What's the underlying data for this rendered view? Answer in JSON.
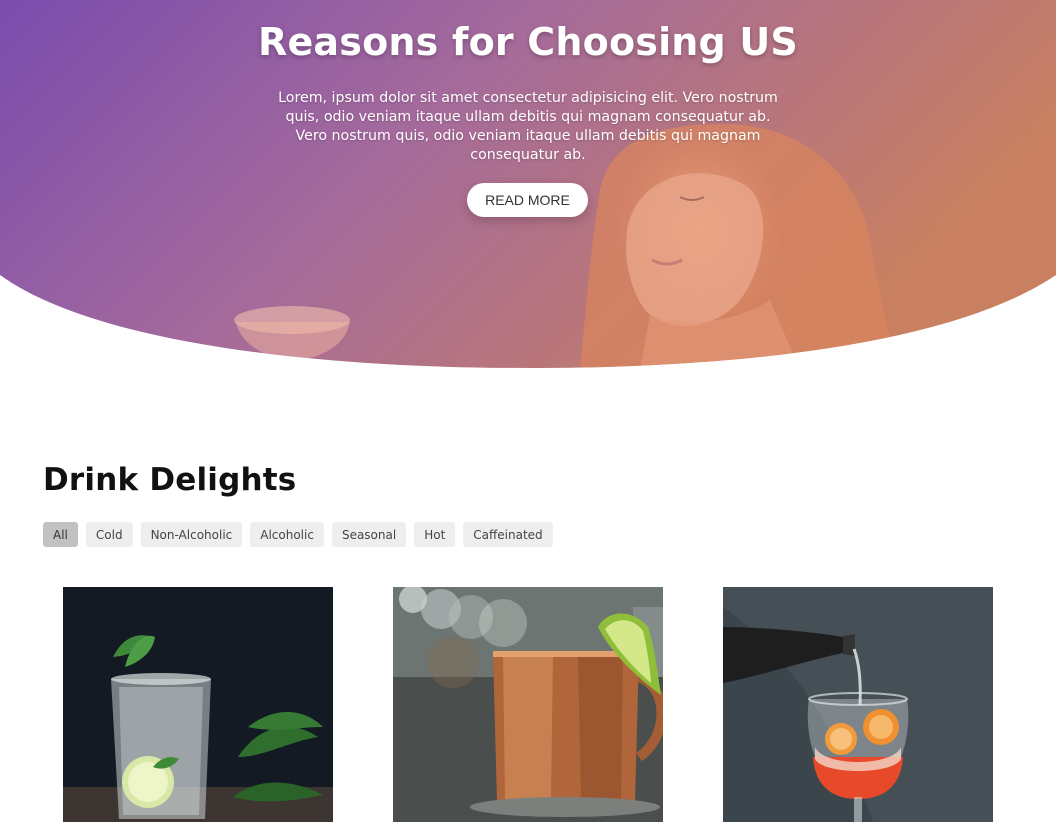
{
  "hero": {
    "title": "Reasons for Choosing US",
    "text": "Lorem, ipsum dolor sit amet consectetur adipisicing elit. Vero nostrum quis, odio veniam itaque ullam debitis qui magnam consequatur ab. Vero nostrum quis, odio veniam itaque ullam debitis qui magnam consequatur ab.",
    "button_label": "READ MORE",
    "gradient_start": "#7d4fb0",
    "gradient_end": "#c87e5c"
  },
  "menu": {
    "title": "Drink Delights",
    "filters": [
      {
        "label": "All",
        "active": true
      },
      {
        "label": "Cold",
        "active": false
      },
      {
        "label": "Non-Alcoholic",
        "active": false
      },
      {
        "label": "Alcoholic",
        "active": false
      },
      {
        "label": "Seasonal",
        "active": false
      },
      {
        "label": "Hot",
        "active": false
      },
      {
        "label": "Caffeinated",
        "active": false
      }
    ],
    "items": [
      {
        "image": "mojito-glass-photo"
      },
      {
        "image": "copper-mug-photo"
      },
      {
        "image": "spritz-pour-photo"
      }
    ]
  }
}
